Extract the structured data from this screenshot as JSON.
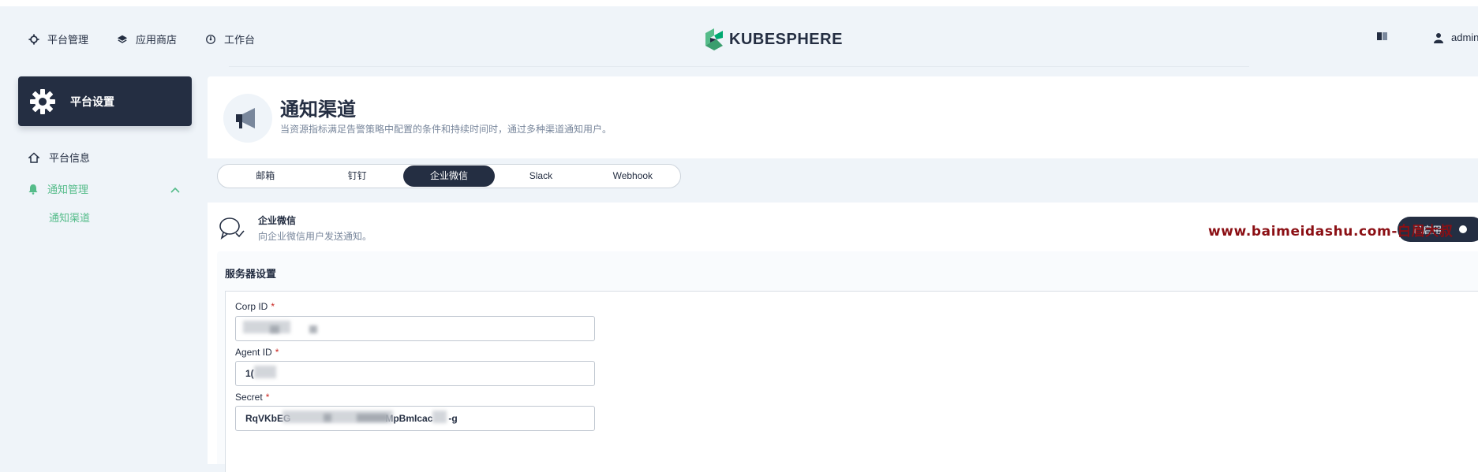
{
  "topbar": {
    "nav": [
      {
        "label": "平台管理",
        "icon": "gear-icon"
      },
      {
        "label": "应用商店",
        "icon": "layers-icon"
      },
      {
        "label": "工作台",
        "icon": "dashboard-icon"
      }
    ],
    "brand": "KUBESPHERE",
    "user": "admin"
  },
  "sidebar": {
    "card_title": "平台设置",
    "items": [
      {
        "label": "平台信息",
        "icon": "home-icon"
      },
      {
        "label": "通知管理",
        "icon": "bell-icon"
      }
    ],
    "sub_item": "通知渠道"
  },
  "header": {
    "title": "通知渠道",
    "description": "当资源指标满足告警策略中配置的条件和持续时间时，通过多种渠道通知用户。"
  },
  "tabs": [
    "邮箱",
    "钉钉",
    "企业微信",
    "Slack",
    "Webhook"
  ],
  "active_tab": "企业微信",
  "panel": {
    "title": "企业微信",
    "description": "向企业微信用户发送通知。",
    "toggle_label": "已启用",
    "watermark": "www.baimeidashu.com-白眉大叔"
  },
  "server": {
    "title": "服务器设置",
    "fields": [
      {
        "label": "Corp ID",
        "value": ""
      },
      {
        "label": "Agent ID",
        "value": "1("
      },
      {
        "label": "Secret",
        "value": "RqVKbEG                                    MpBmIcac      -g"
      }
    ]
  },
  "colors": {
    "accent": "#55bc8a",
    "dark": "#242e42",
    "required": "#ca2621",
    "watermark": "#8b0f14"
  }
}
